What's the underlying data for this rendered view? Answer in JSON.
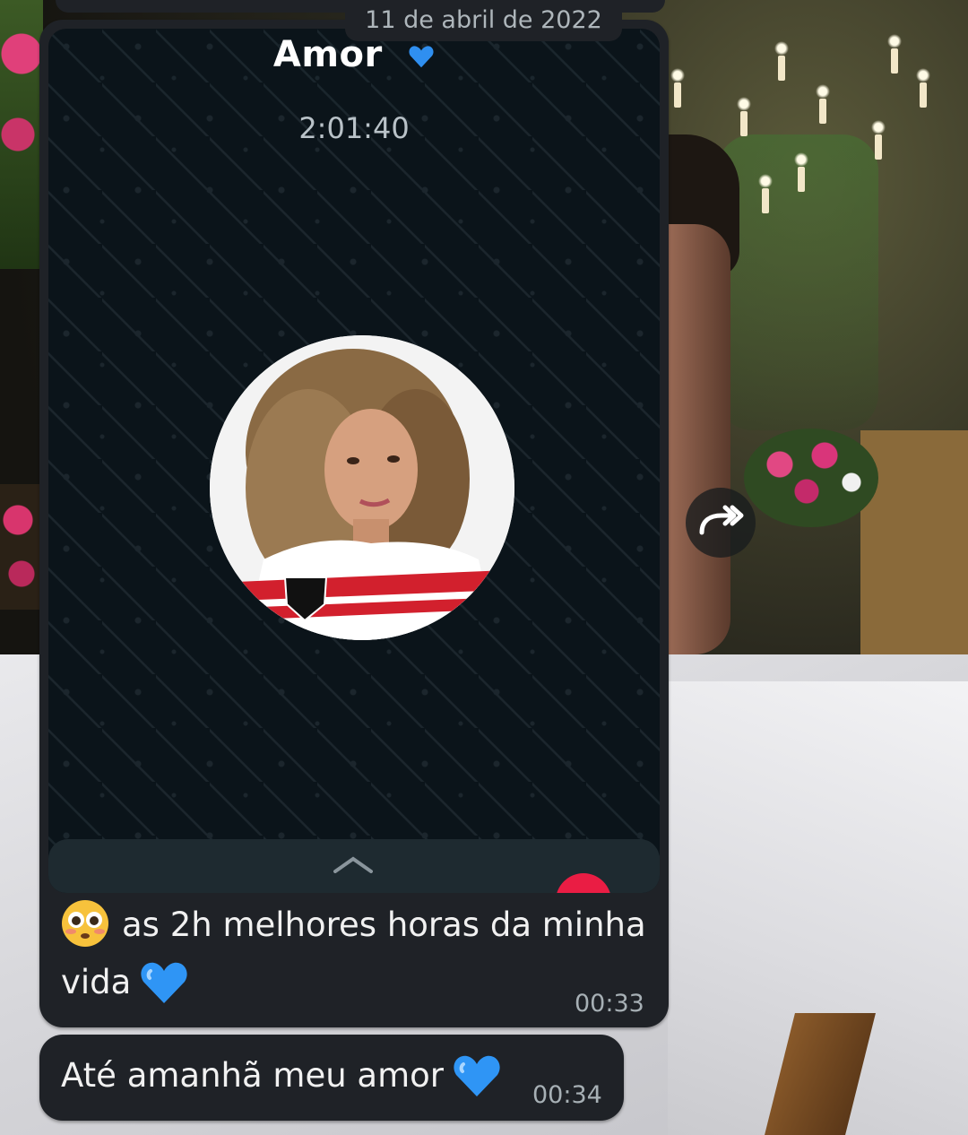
{
  "screen": {
    "date_chip": "11 de abril de 2022",
    "call_screenshot": {
      "contact_name": "Amor",
      "call_duration": "2:01:40",
      "heart_icon": "blue-heart-icon",
      "avatar_icon": "contact-avatar-photo",
      "chevron_icon": "chevron-up-icon",
      "end_call_icon": "end-call-icon"
    },
    "messages": [
      {
        "emoji": "flushed-face-emoji",
        "text": "as 2h melhores horas da minha vida",
        "line1": "as 2h melhores horas da minha",
        "line2": "vida",
        "heart": "blue-heart-emoji",
        "time": "00:33"
      },
      {
        "text": "Até amanhã meu amor",
        "heart": "blue-heart-emoji",
        "time": "00:34"
      }
    ],
    "forward_icon": "forward-icon"
  },
  "colors": {
    "bubble": "#1f2227",
    "text": "#f1f1f1",
    "time": "#a7b0b5",
    "call_bg": "#0b141a",
    "heart": "#3aa0ff",
    "end_call": "#ea1d44"
  }
}
